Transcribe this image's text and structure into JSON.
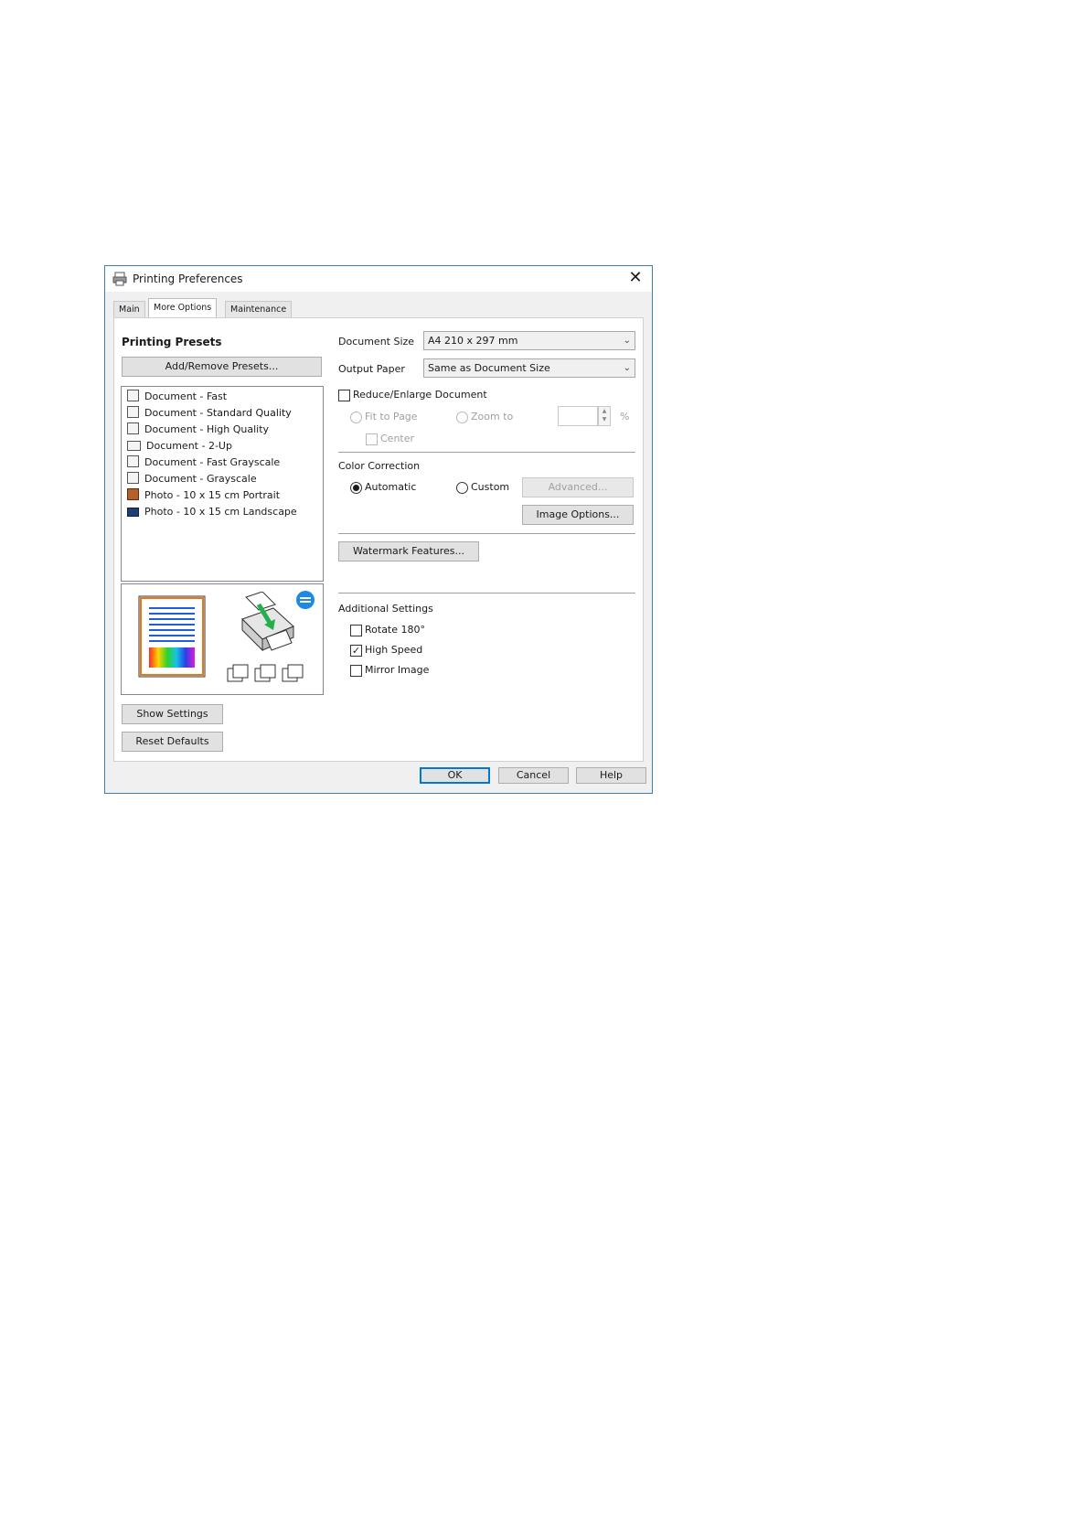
{
  "window": {
    "title": "Printing Preferences",
    "close_label": "✕"
  },
  "tabs": [
    {
      "label": "Main"
    },
    {
      "label": "More Options"
    },
    {
      "label": "Maintenance"
    }
  ],
  "presets": {
    "heading": "Printing Presets",
    "add_remove_button": "Add/Remove Presets...",
    "items": [
      {
        "label": "Document - Fast",
        "icon": "document-icon"
      },
      {
        "label": "Document - Standard Quality",
        "icon": "document-icon"
      },
      {
        "label": "Document - High Quality",
        "icon": "document-icon"
      },
      {
        "label": "Document - 2-Up",
        "icon": "two-up-icon"
      },
      {
        "label": "Document - Fast Grayscale",
        "icon": "document-icon"
      },
      {
        "label": "Document - Grayscale",
        "icon": "document-icon"
      },
      {
        "label": "Photo - 10 x 15 cm Portrait",
        "icon": "photo-icon"
      },
      {
        "label": "Photo - 10 x 15 cm Landscape",
        "icon": "photo-landscape-icon"
      }
    ]
  },
  "left_buttons": {
    "show_settings": "Show Settings",
    "reset_defaults": "Reset Defaults"
  },
  "document_size": {
    "label": "Document Size",
    "value": "A4 210 x 297 mm"
  },
  "output_paper": {
    "label": "Output Paper",
    "value": "Same as Document Size"
  },
  "reduce_enlarge": {
    "label": "Reduce/Enlarge Document",
    "checked": false,
    "fit_to_page": "Fit to Page",
    "zoom_to": "Zoom to",
    "percent": "%",
    "center": "Center"
  },
  "color_correction": {
    "heading": "Color Correction",
    "automatic": "Automatic",
    "custom": "Custom",
    "selected": "automatic",
    "advanced_button": "Advanced...",
    "image_options_button": "Image Options..."
  },
  "watermark_button": "Watermark Features...",
  "additional_settings": {
    "heading": "Additional Settings",
    "rotate": {
      "label": "Rotate 180°",
      "checked": false
    },
    "high_speed": {
      "label": "High Speed",
      "checked": true
    },
    "mirror": {
      "label": "Mirror Image",
      "checked": false
    }
  },
  "footer": {
    "ok": "OK",
    "cancel": "Cancel",
    "help": "Help"
  },
  "colors": {
    "window_border": "#3c7fb1",
    "dialog_bg": "#f0f0f0",
    "accent": "#0078d7",
    "preview_page_lines": "#1f5fd6"
  }
}
